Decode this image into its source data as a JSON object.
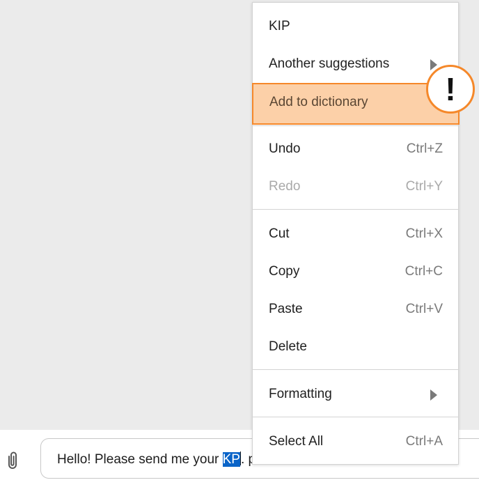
{
  "composer": {
    "text_before": "Hello! Please send me your ",
    "selected_word": "KP",
    "text_after": ". p"
  },
  "context_menu": {
    "suggestion": "KIP",
    "another_suggestions": "Another suggestions",
    "add_to_dictionary": "Add to dictionary",
    "undo": {
      "label": "Undo",
      "shortcut": "Ctrl+Z"
    },
    "redo": {
      "label": "Redo",
      "shortcut": "Ctrl+Y"
    },
    "cut": {
      "label": "Cut",
      "shortcut": "Ctrl+X"
    },
    "copy": {
      "label": "Copy",
      "shortcut": "Ctrl+C"
    },
    "paste": {
      "label": "Paste",
      "shortcut": "Ctrl+V"
    },
    "delete": {
      "label": "Delete"
    },
    "formatting": {
      "label": "Formatting"
    },
    "select_all": {
      "label": "Select All",
      "shortcut": "Ctrl+A"
    }
  },
  "callout": {
    "symbol": "!"
  },
  "colors": {
    "highlight_fill": "#fcd0a8",
    "highlight_border": "#f5882a",
    "selection": "#0a64c8"
  },
  "icons": [
    "paperclip-icon",
    "submenu-arrow-icon"
  ]
}
